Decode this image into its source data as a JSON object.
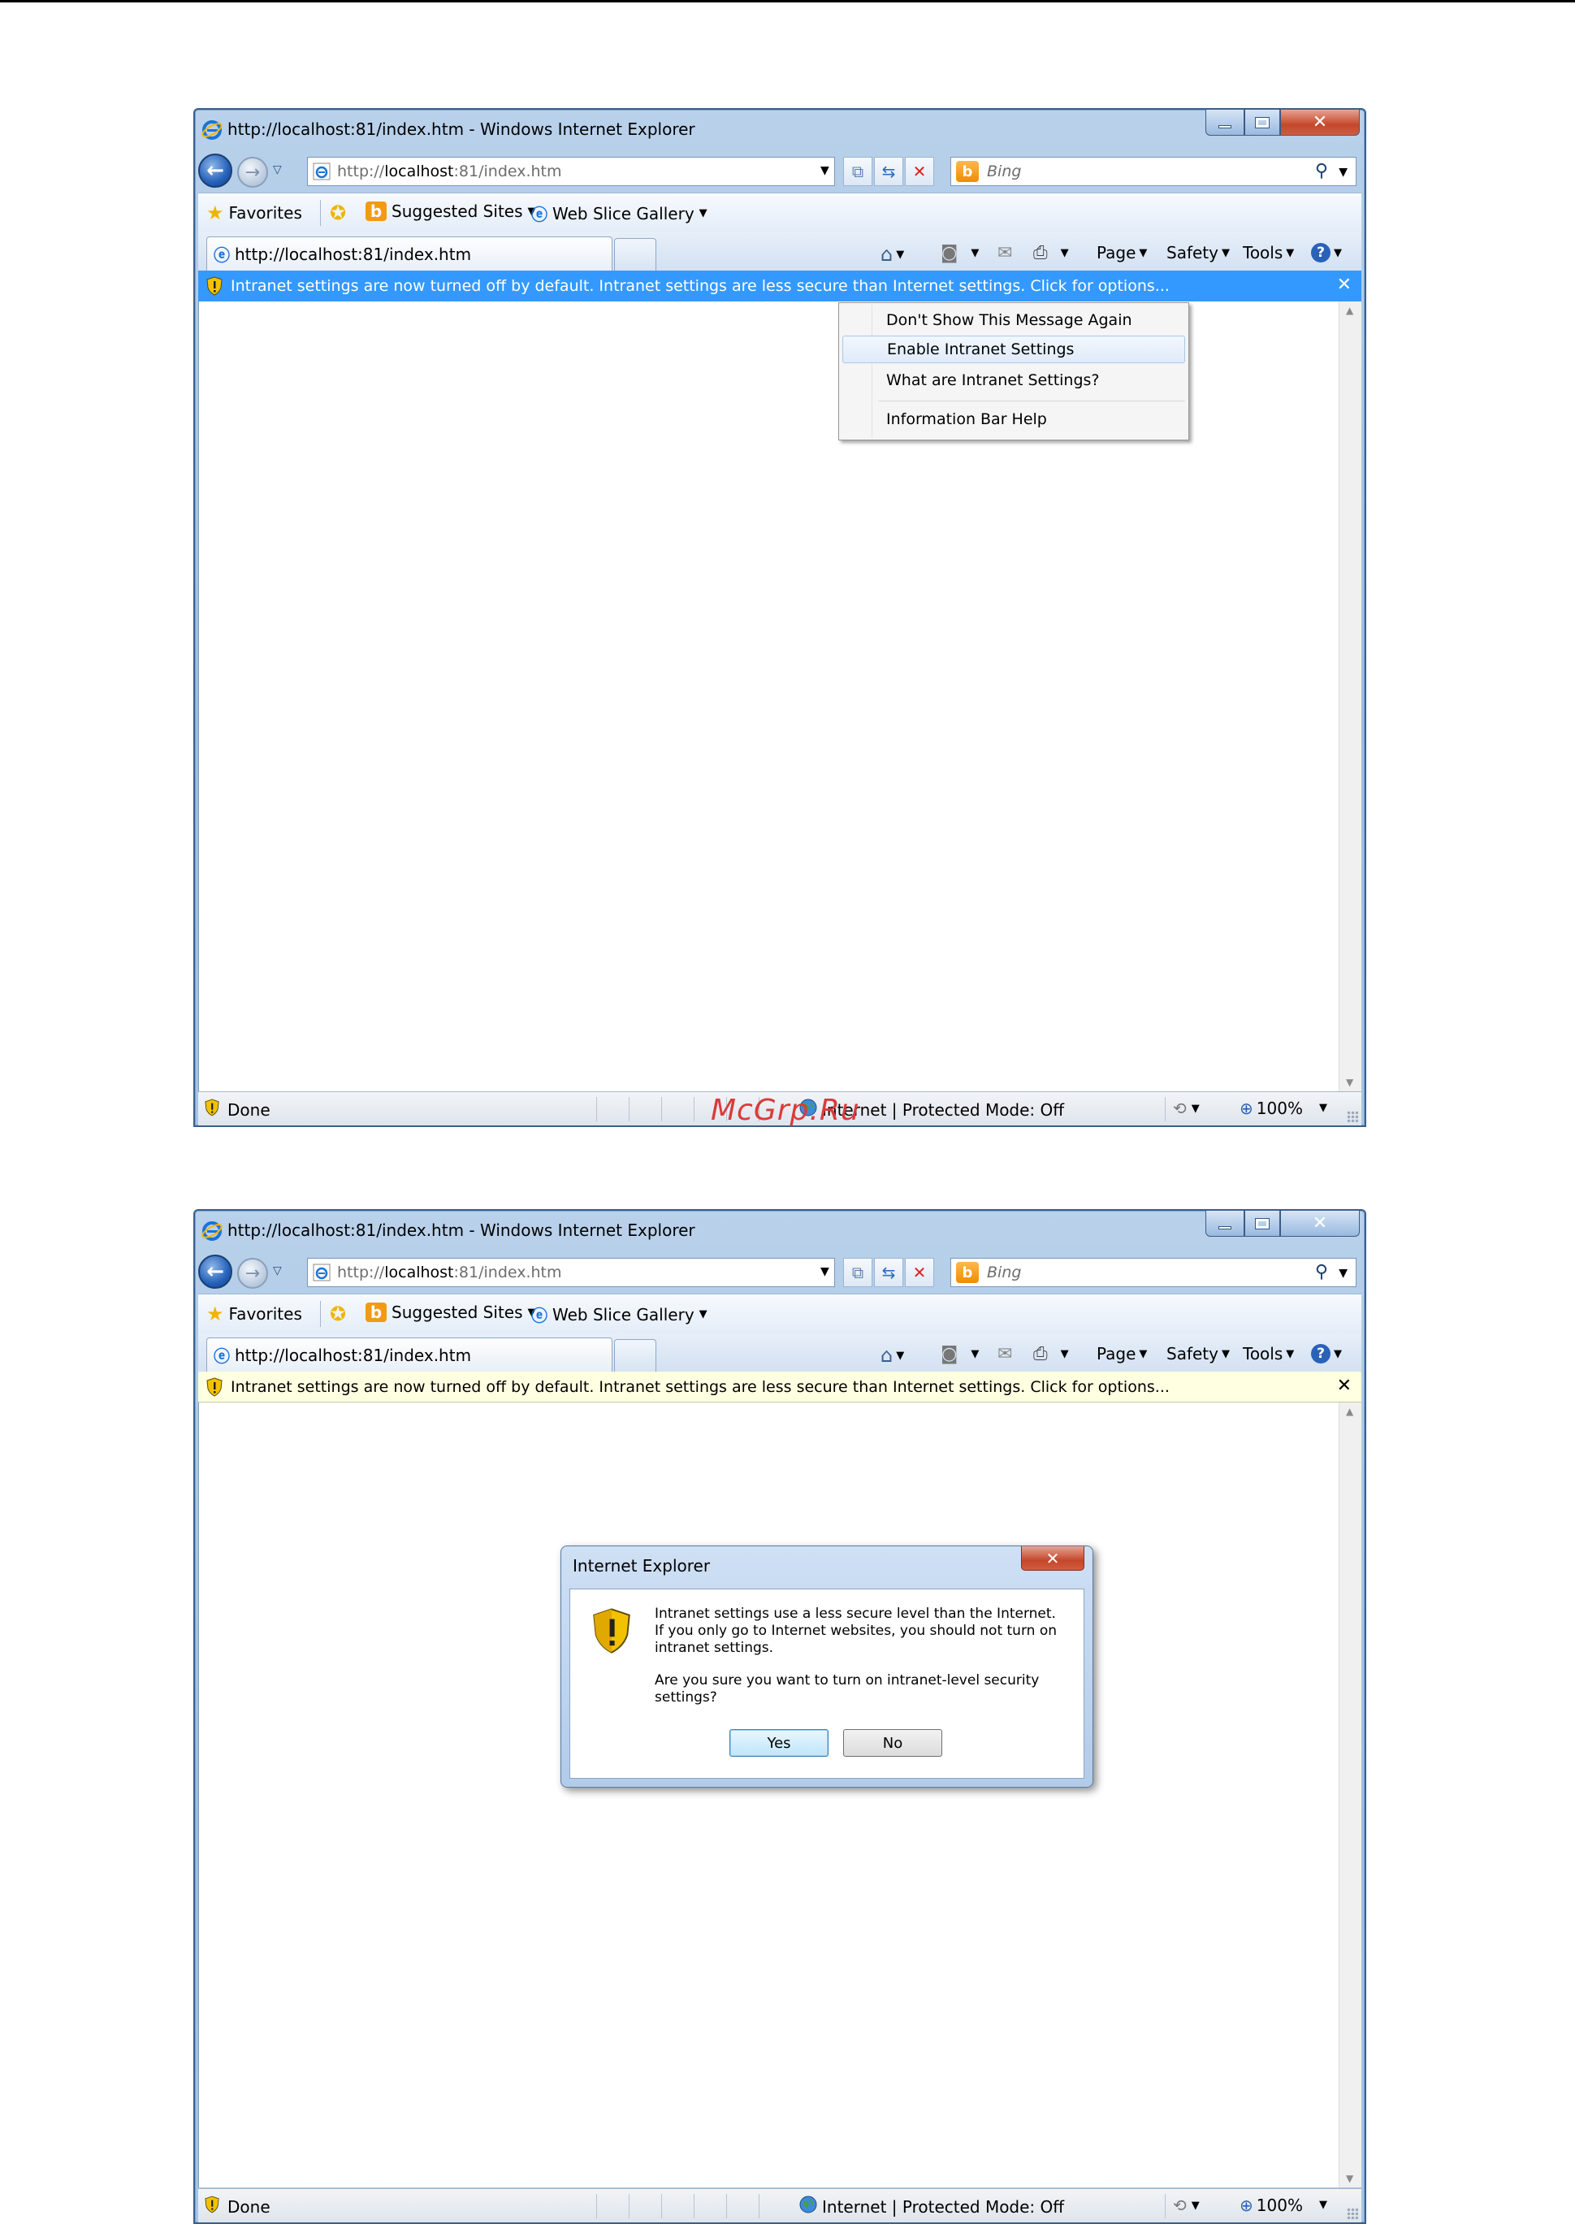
{
  "window": {
    "title": "http://localhost:81/index.htm - Windows Internet Explorer",
    "address_prefix": "http://",
    "address_host": "localhost",
    "address_rest": ":81/index.htm",
    "search_placeholder": "Bing",
    "search_logo": "b",
    "tab_title": "http://localhost:81/index.htm"
  },
  "favorites": {
    "favorites_label": "Favorites",
    "suggested_sites": "Suggested Sites",
    "web_slice_gallery": "Web Slice Gallery"
  },
  "commands": {
    "page": "Page",
    "safety": "Safety",
    "tools": "Tools"
  },
  "infobar": {
    "text_partial": "Intranet settings are now turned off by default. Intranet settings are less secure than Internet settings. Click for options...",
    "text_full": "Intranet settings are now turned off by default. Intranet settings are less secure than Internet settings. Click for options..."
  },
  "context_menu": {
    "items": [
      "Don't Show This Message Again",
      "Enable Intranet Settings",
      "What are Intranet Settings?",
      "Information Bar Help"
    ]
  },
  "status": {
    "done": "Done",
    "zone": "Internet | Protected Mode: Off",
    "zoom": "100%"
  },
  "dialog": {
    "title": "Internet Explorer",
    "message1": "Intranet settings use a less secure level than the Internet. If you only go to Internet websites, you should not turn on intranet settings.",
    "message2": "Are you sure you want to turn on intranet-level security settings?",
    "yes": "Yes",
    "no": "No"
  },
  "watermark": "McGrp.Ru",
  "colors": {
    "infobar_active": "#3399ff",
    "infobar_normal": "#ffffe1",
    "watermark": "#d93b3b"
  }
}
